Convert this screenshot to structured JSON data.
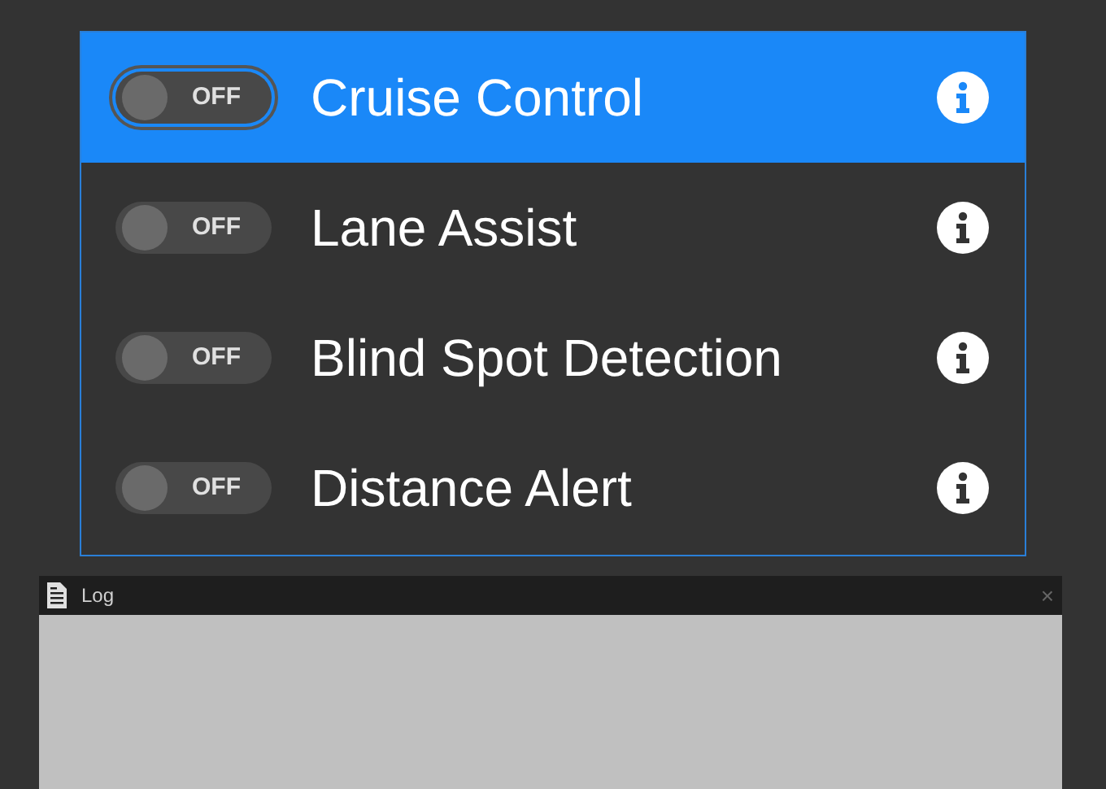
{
  "features": [
    {
      "label": "Cruise Control",
      "selected": true,
      "on": false,
      "toggle_text": "OFF"
    },
    {
      "label": "Lane Assist",
      "selected": false,
      "on": false,
      "toggle_text": "OFF"
    },
    {
      "label": "Blind Spot Detection",
      "selected": false,
      "on": false,
      "toggle_text": "OFF"
    },
    {
      "label": "Distance Alert",
      "selected": false,
      "on": false,
      "toggle_text": "OFF"
    }
  ],
  "log": {
    "title": "Log",
    "close": "×"
  }
}
